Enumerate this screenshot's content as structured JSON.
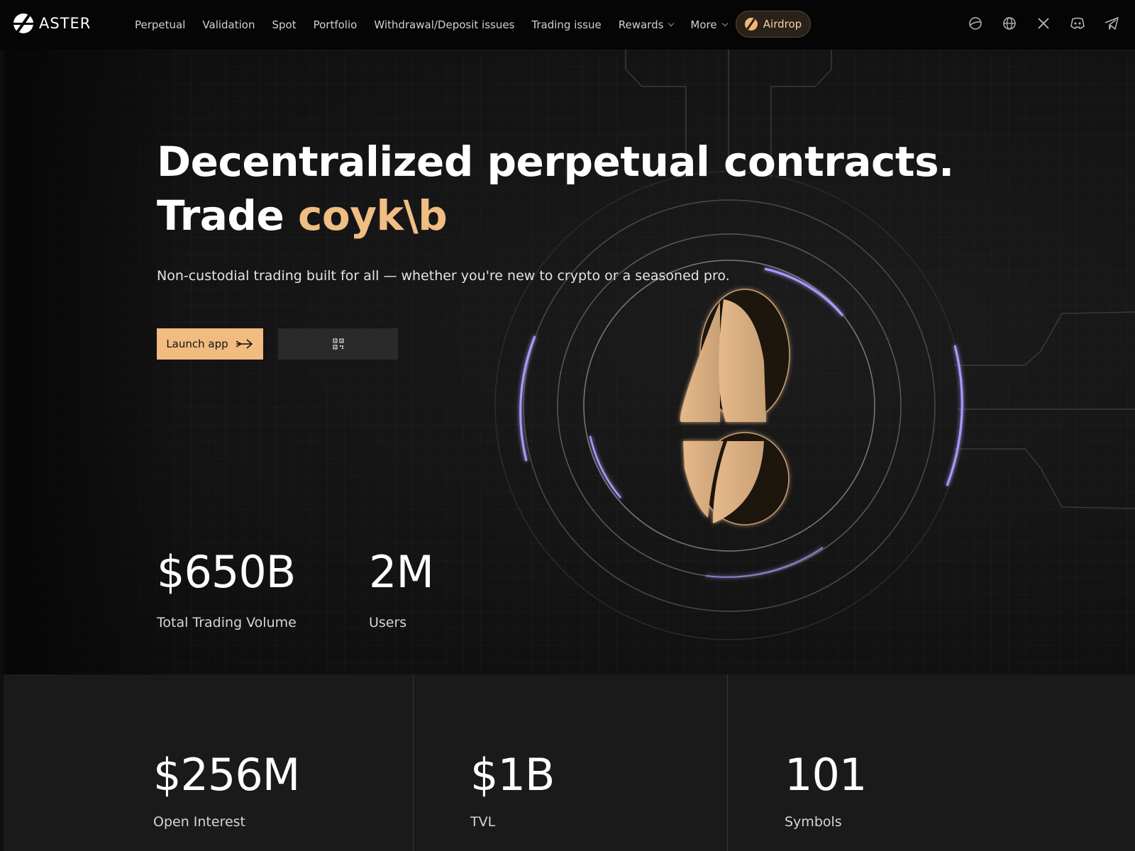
{
  "brand": {
    "name": "ASTER"
  },
  "nav": {
    "items": [
      {
        "label": "Perpetual"
      },
      {
        "label": "Validation"
      },
      {
        "label": "Spot"
      },
      {
        "label": "Portfolio"
      },
      {
        "label": "Withdrawal/Deposit issues"
      },
      {
        "label": "Trading issue"
      },
      {
        "label": "Rewards",
        "dropdown": true
      },
      {
        "label": "More",
        "dropdown": true
      }
    ],
    "airdrop_label": "Airdrop",
    "icons": [
      "theme-icon",
      "globe-icon",
      "x-icon",
      "discord-icon",
      "telegram-icon"
    ]
  },
  "hero": {
    "headline_line1": "Decentralized perpetual contracts.",
    "headline_trade": "Trade",
    "headline_accent": "coyk\\b",
    "subtitle": "Non-custodial trading built for all — whether you're new to crypto or a seasoned pro.",
    "launch_label": "Launch app",
    "qr_icon": "qr-code-icon"
  },
  "stats": [
    {
      "value": "$650B",
      "label": "Total Trading Volume"
    },
    {
      "value": "2M",
      "label": "Users"
    }
  ],
  "bottom_stats": [
    {
      "value": "$256M",
      "label": "Open Interest"
    },
    {
      "value": "$1B",
      "label": "TVL"
    },
    {
      "value": "101",
      "label": "Symbols"
    }
  ],
  "colors": {
    "accent": "#f0bd83",
    "button": "#f2bb7f",
    "glow": "#a99cff",
    "background": "#131313"
  }
}
